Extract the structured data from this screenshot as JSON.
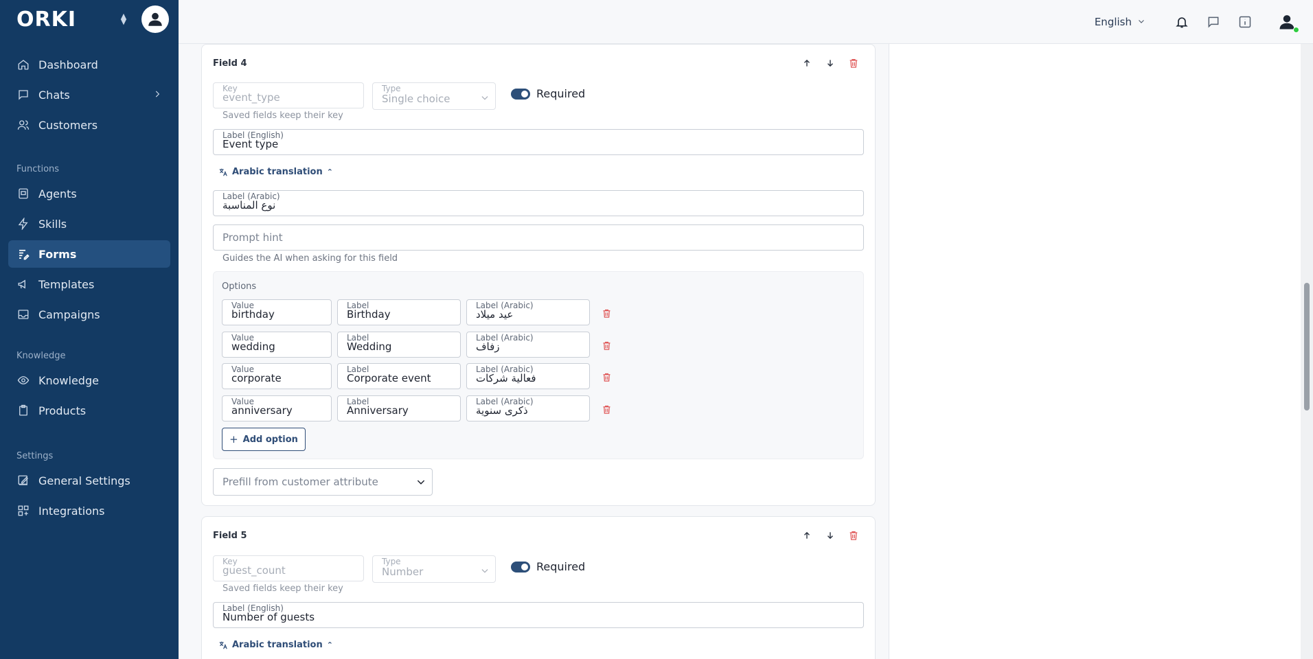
{
  "sidebar": {
    "logo": "ORKI",
    "items_top": [
      {
        "label": "Dashboard",
        "icon": "home-icon"
      },
      {
        "label": "Chats",
        "icon": "chat-icon",
        "has_chevron": true
      },
      {
        "label": "Customers",
        "icon": "users-icon"
      }
    ],
    "section_functions": "Functions",
    "items_functions": [
      {
        "label": "Agents",
        "icon": "agent-icon"
      },
      {
        "label": "Skills",
        "icon": "lightning-icon"
      },
      {
        "label": "Forms",
        "icon": "form-icon",
        "active": true
      },
      {
        "label": "Templates",
        "icon": "megaphone-icon"
      },
      {
        "label": "Campaigns",
        "icon": "campaign-icon"
      }
    ],
    "section_knowledge": "Knowledge",
    "items_knowledge": [
      {
        "label": "Knowledge",
        "icon": "eye-icon"
      },
      {
        "label": "Products",
        "icon": "clipboard-icon"
      }
    ],
    "section_settings": "Settings",
    "items_settings": [
      {
        "label": "General Settings",
        "icon": "edit-icon"
      },
      {
        "label": "Integrations",
        "icon": "grid-icon"
      }
    ]
  },
  "topbar": {
    "language": "English"
  },
  "field4": {
    "title": "Field 4",
    "key_label": "Key",
    "key_value": "event_type",
    "type_label": "Type",
    "type_value": "Single choice",
    "required_label": "Required",
    "key_helper": "Saved fields keep their key",
    "label_en_label": "Label (English)",
    "label_en_value": "Event type",
    "translation_toggle": "Arabic translation",
    "label_ar_label": "Label (Arabic)",
    "label_ar_value": "نوع المناسبة",
    "prompt_hint_placeholder": "Prompt hint",
    "prompt_helper": "Guides the AI when asking for this field",
    "options_title": "Options",
    "col_value": "Value",
    "col_label": "Label",
    "col_label_ar": "Label (Arabic)",
    "options": [
      {
        "value": "birthday",
        "label": "Birthday",
        "label_ar": "عيد ميلاد"
      },
      {
        "value": "wedding",
        "label": "Wedding",
        "label_ar": "زفاف"
      },
      {
        "value": "corporate",
        "label": "Corporate event",
        "label_ar": "فعالية شركات"
      },
      {
        "value": "anniversary",
        "label": "Anniversary",
        "label_ar": "ذكرى سنوية"
      }
    ],
    "add_option": "Add option",
    "prefill_placeholder": "Prefill from customer attribute"
  },
  "field5": {
    "title": "Field 5",
    "key_label": "Key",
    "key_value": "guest_count",
    "type_label": "Type",
    "type_value": "Number",
    "required_label": "Required",
    "key_helper": "Saved fields keep their key",
    "label_en_label": "Label (English)",
    "label_en_value": "Number of guests",
    "translation_toggle": "Arabic translation"
  },
  "colors": {
    "sidebar_bg": "#133a63",
    "sidebar_active": "#24507f",
    "accent": "#2d4f79",
    "danger": "#e05a5a"
  }
}
